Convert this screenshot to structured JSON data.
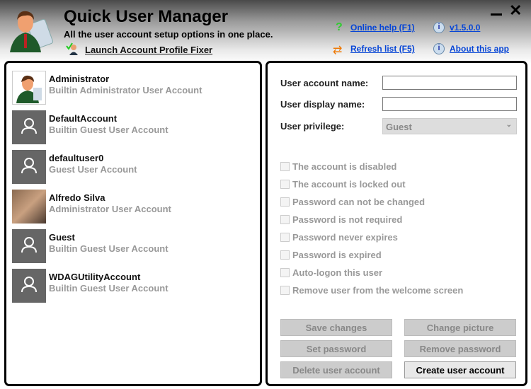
{
  "header": {
    "title": "Quick User Manager",
    "subtitle": "All the user account setup options in one place.",
    "fixer_link": "Launch Account Profile Fixer",
    "online_help": "Online help (F1)",
    "version": "v1.5.0.0",
    "refresh": "Refresh list (F5)",
    "about": "About this app"
  },
  "users": [
    {
      "name": "Administrator",
      "desc": "Builtin Administrator User Account",
      "avatar": "admin-picture"
    },
    {
      "name": "DefaultAccount",
      "desc": "Builtin Guest User Account",
      "avatar": "default-user-icon"
    },
    {
      "name": "defaultuser0",
      "desc": "Guest User Account",
      "avatar": "default-user-icon"
    },
    {
      "name": "Alfredo Silva",
      "desc": "Administrator User Account",
      "avatar": "photo"
    },
    {
      "name": "Guest",
      "desc": "Builtin Guest User Account",
      "avatar": "default-user-icon"
    },
    {
      "name": "WDAGUtilityAccount",
      "desc": "Builtin Guest User Account",
      "avatar": "default-user-icon"
    }
  ],
  "form": {
    "account_name_label": "User account name:",
    "account_name_value": "",
    "display_name_label": "User display name:",
    "display_name_value": "",
    "privilege_label": "User privilege:",
    "privilege_value": "Guest"
  },
  "options": [
    "The account is disabled",
    "The account is locked out",
    "Password can not be changed",
    "Password is not required",
    "Password never expires",
    "Password is expired",
    "Auto-logon this user",
    "Remove user from the welcome screen"
  ],
  "buttons": {
    "save": "Save changes",
    "change_picture": "Change picture",
    "set_password": "Set password",
    "remove_password": "Remove password",
    "delete": "Delete user account",
    "create": "Create user account"
  }
}
